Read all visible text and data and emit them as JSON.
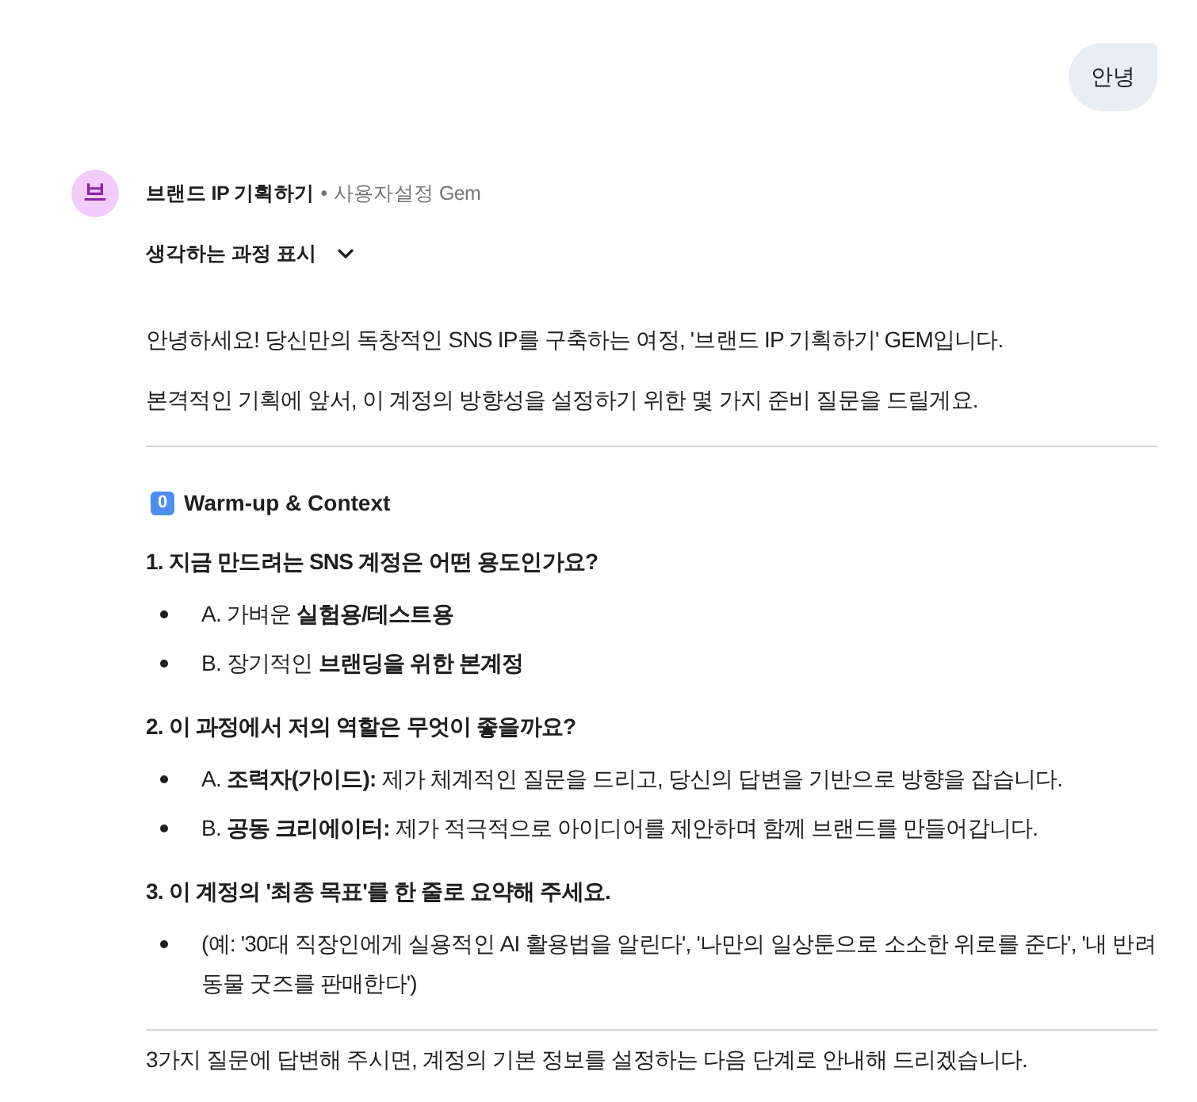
{
  "user_message": {
    "text": "안녕"
  },
  "response": {
    "avatar": {
      "letter": "브"
    },
    "gem_name": "브랜드 IP 기획하기",
    "separator": "•",
    "gem_type": "사용자설정 Gem",
    "thinking_toggle": {
      "label": "생각하는 과정 표시",
      "expanded": false
    },
    "blocks": [
      {
        "kind": "paragraph",
        "text": "안녕하세요! 당신만의 독창적인 SNS IP를 구축하는 여정, '브랜드 IP 기획하기' GEM입니다."
      },
      {
        "kind": "paragraph",
        "text": "본격적인 기획에 앞서, 이 계정의 방향성을 설정하기 위한 몇 가지 준비 질문을 드릴게요."
      },
      {
        "kind": "divider"
      },
      {
        "kind": "heading",
        "keycap": "0",
        "text": "Warm-up & Context"
      },
      {
        "kind": "question",
        "text": "1. 지금 만드려는 SNS 계정은 어떤 용도인가요?"
      },
      {
        "kind": "bullets",
        "items": [
          "A. 가벼운 **실험용/테스트용**",
          "B. 장기적인 **브랜딩을 위한 본계정**"
        ]
      },
      {
        "kind": "question",
        "text": "2. 이 과정에서 저의 역할은 무엇이 좋을까요?"
      },
      {
        "kind": "bullets",
        "items": [
          "A. **조력자(가이드):** 제가 체계적인 질문을 드리고, 당신의 답변을 기반으로 방향을 잡습니다.",
          "B. **공동 크리에이터:** 제가 적극적으로 아이디어를 제안하며 함께 브랜드를 만들어갑니다."
        ]
      },
      {
        "kind": "question",
        "text": "3. 이 계정의 '최종 목표'를 한 줄로 요약해 주세요."
      },
      {
        "kind": "bullets",
        "items": [
          "(예: '30대 직장인에게 실용적인 AI 활용법을 알린다', '나만의 일상툰으로 소소한 위로를 준다', '내 반려 동물 굿즈를 판매한다')"
        ]
      },
      {
        "kind": "divider"
      },
      {
        "kind": "paragraph",
        "text": "3가지 질문에 답변해 주시면, 계정의 기본 정보를 설정하는 다음 단계로 안내해 드리겠습니다."
      }
    ]
  }
}
